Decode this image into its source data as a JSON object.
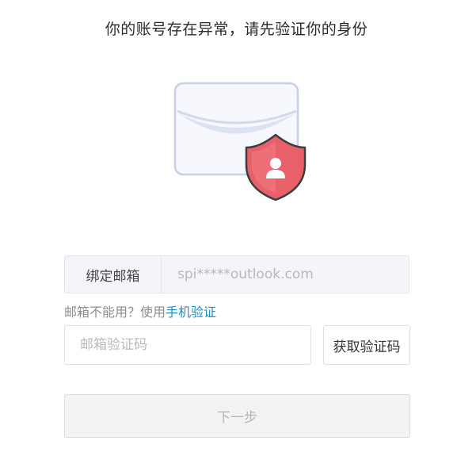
{
  "title": "你的账号存在异常，请先验证你的身份",
  "illustration": {
    "envelope_icon": "envelope-icon",
    "shield_icon": "shield-user-icon",
    "shield_color": "#e8606a"
  },
  "bound_email": {
    "label": "绑定邮箱",
    "value": "spi*****outlook.com"
  },
  "alternate": {
    "prefix": "邮箱不能用？使用",
    "link": "手机验证"
  },
  "code_input": {
    "placeholder": "邮箱验证码",
    "value": ""
  },
  "get_code_button": "获取验证码",
  "next_button": "下一步",
  "colors": {
    "link": "#1e8fbf",
    "disabled_text": "#b3b4b8"
  }
}
